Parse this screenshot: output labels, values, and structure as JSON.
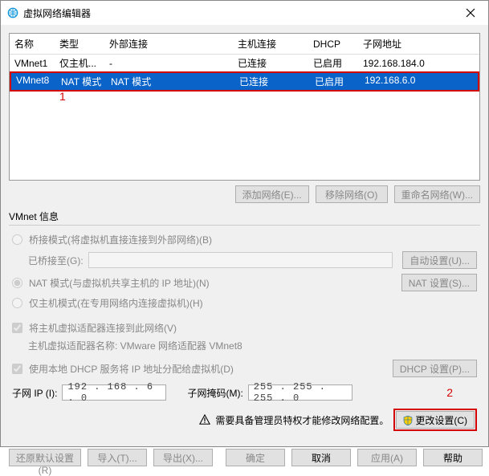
{
  "window": {
    "title": "虚拟网络编辑器"
  },
  "table": {
    "headers": {
      "name": "名称",
      "type": "类型",
      "ext": "外部连接",
      "host": "主机连接",
      "dhcp": "DHCP",
      "subnet": "子网地址"
    },
    "rows": [
      {
        "name": "VMnet1",
        "type": "仅主机...",
        "ext": "-",
        "host": "已连接",
        "dhcp": "已启用",
        "subnet": "192.168.184.0",
        "selected": false
      },
      {
        "name": "VMnet8",
        "type": "NAT 模式",
        "ext": "NAT 模式",
        "host": "已连接",
        "dhcp": "已启用",
        "subnet": "192.168.6.0",
        "selected": true
      }
    ],
    "annot1": "1"
  },
  "net_buttons": {
    "add": "添加网络(E)...",
    "remove": "移除网络(O)",
    "rename": "重命名网络(W)..."
  },
  "info": {
    "title": "VMnet 信息",
    "bridged": "桥接模式(将虚拟机直接连接到外部网络)(B)",
    "bridged_to_label": "已桥接至(G):",
    "bridged_auto_btn": "自动设置(U)...",
    "nat": "NAT 模式(与虚拟机共享主机的 IP 地址)(N)",
    "nat_btn": "NAT 设置(S)...",
    "hostonly": "仅主机模式(在专用网络内连接虚拟机)(H)",
    "connect_host": "将主机虚拟适配器连接到此网络(V)",
    "host_adapter_label": "主机虚拟适配器名称: VMware 网络适配器 VMnet8",
    "use_dhcp": "使用本地 DHCP 服务将 IP 地址分配给虚拟机(D)",
    "dhcp_btn": "DHCP 设置(P)...",
    "subnet_ip_label": "子网 IP (I):",
    "subnet_ip_value": "192 . 168 .   6 .   0",
    "subnet_mask_label": "子网掩码(M):",
    "subnet_mask_value": "255 . 255 . 255 .   0",
    "annot2": "2"
  },
  "admin": {
    "warn_text": "需要具备管理员特权才能修改网络配置。",
    "change_btn": "更改设置(C)"
  },
  "bottom": {
    "restore": "还原默认设置(R)",
    "import": "导入(T)...",
    "export": "导出(X)...",
    "ok": "确定",
    "cancel": "取消",
    "apply": "应用(A)",
    "help": "帮助"
  }
}
